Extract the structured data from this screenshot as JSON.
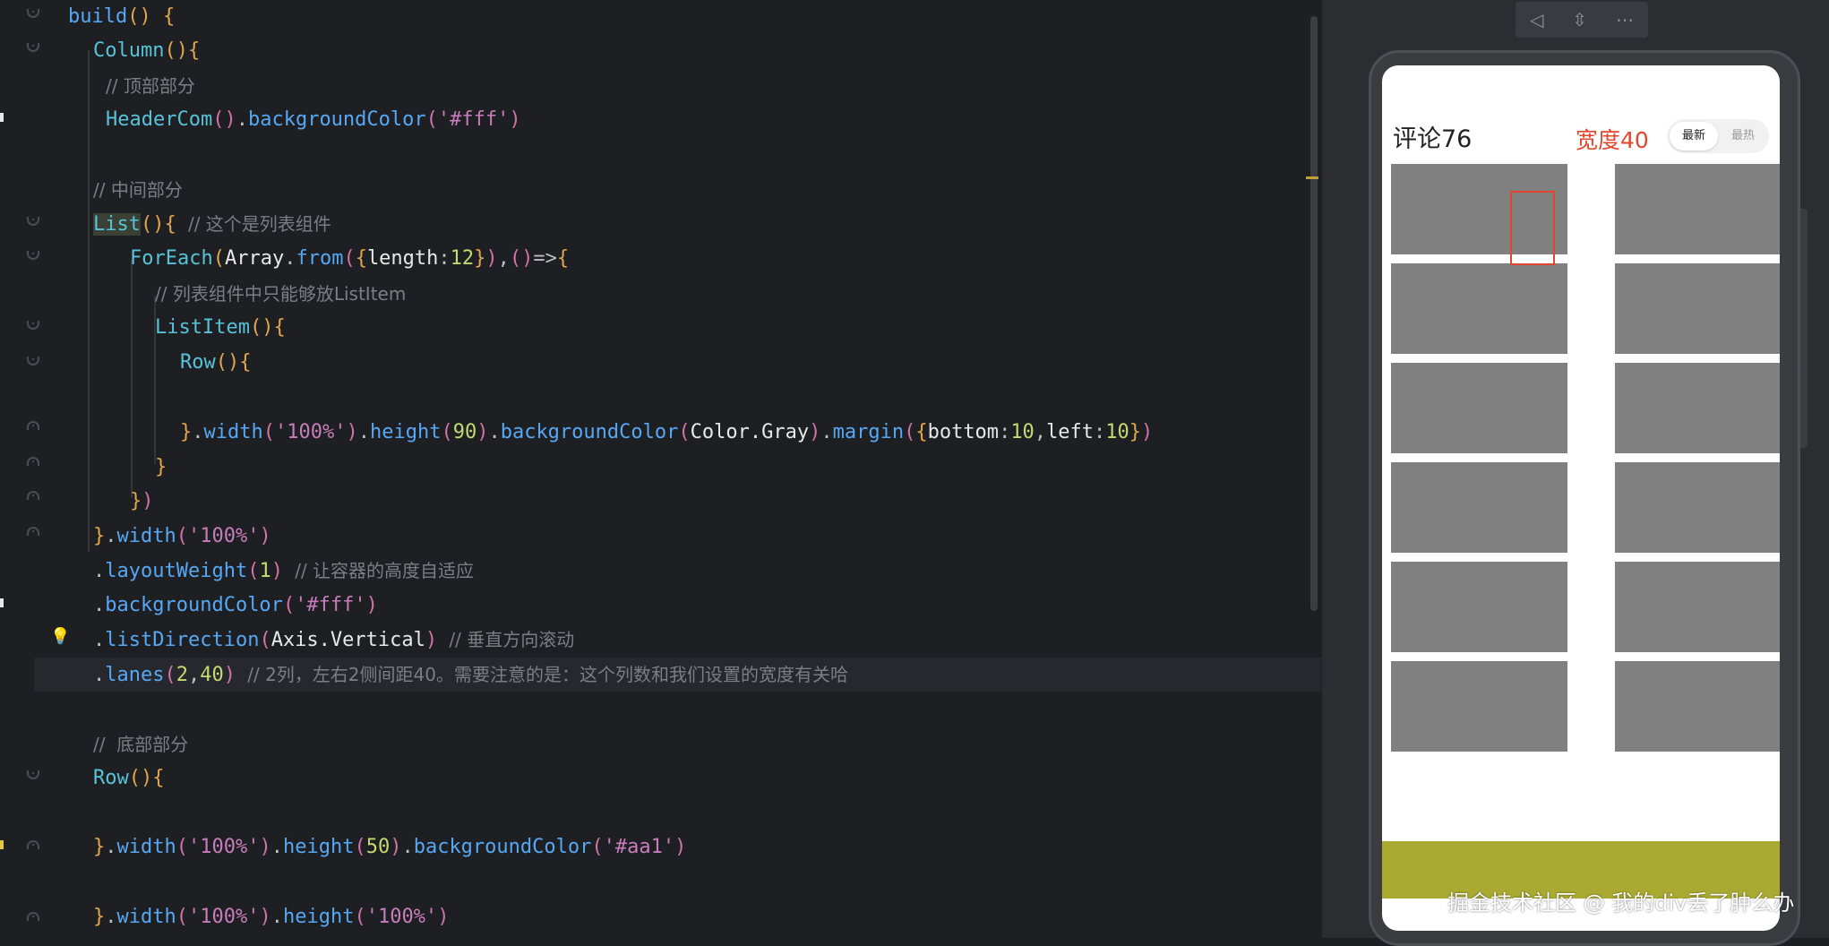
{
  "editor": {
    "lines": [
      {
        "id": "l1"
      },
      {
        "id": "l2"
      }
    ],
    "code": {
      "build": "build",
      "column": "Column",
      "comment_top": "// 顶部部分",
      "header_com": "HeaderCom",
      "background_color": "backgroundColor",
      "fff": "'#fff'",
      "comment_middle": "// 中间部分",
      "list": "List",
      "comment_list": "// 这个是列表组件",
      "for_each": "ForEach",
      "array": "Array",
      "from": "from",
      "length": "length",
      "twelve": "12",
      "comment_listitem": "// 列表组件中只能够放ListItem",
      "list_item": "ListItem",
      "row": "Row",
      "width": "width",
      "pct100": "'100%'",
      "height": "height",
      "ninety": "90",
      "color_gray": "Color.Gray",
      "margin": "margin",
      "bottom": "bottom",
      "left": "left",
      "ten": "10",
      "layout_weight": "layoutWeight",
      "one": "1",
      "comment_layout": "// 让容器的高度自适应",
      "list_direction": "listDirection",
      "axis_vertical": "Axis.Vertical",
      "comment_vertical": "// 垂直方向滚动",
      "lanes": "lanes",
      "two": "2",
      "forty": "40",
      "comment_lanes": "// 2列，左右2侧间距40。需要注意的是：这个列数和我们设置的宽度有关哈",
      "comment_bottom": "//  底部部分",
      "fifty": "50",
      "aa1": "'#aa1'"
    }
  },
  "preview": {
    "toolbar": {
      "back_icon": "◁",
      "rotate_icon": "⇳",
      "more_icon": "⋯"
    },
    "header_title": "评论76",
    "width_label": "宽度40",
    "tabs": {
      "latest": "最新",
      "hot": "最热"
    },
    "footer_color": "#aaaa33",
    "cell_color": "#808080",
    "rows": 6,
    "columns": 2
  },
  "watermark": "掘金技术社区 @ 我的div丢了肿么办"
}
